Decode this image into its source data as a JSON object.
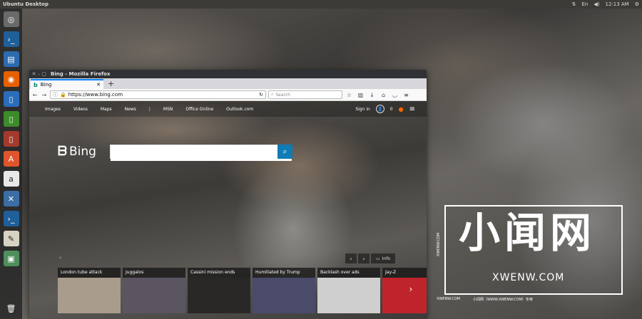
{
  "top_panel": {
    "title": "Ubuntu Desktop",
    "clock": "12:13 AM",
    "kbd": "En"
  },
  "launcher": {
    "items": [
      {
        "name": "ubuntu-dash-icon",
        "color": "#6a6a6a",
        "glyph": "◎"
      },
      {
        "name": "terminal-icon",
        "color": "#1f5f9a",
        "glyph": "›_"
      },
      {
        "name": "files-icon",
        "color": "#2d6bb0",
        "glyph": "▤"
      },
      {
        "name": "firefox-icon",
        "color": "#e66000",
        "glyph": "◉"
      },
      {
        "name": "libreoffice-writer-icon",
        "color": "#2a6ebb",
        "glyph": "▯"
      },
      {
        "name": "libreoffice-calc-icon",
        "color": "#3c8c2a",
        "glyph": "▯"
      },
      {
        "name": "libreoffice-impress-icon",
        "color": "#a33b2c",
        "glyph": "▯"
      },
      {
        "name": "software-center-icon",
        "color": "#e0552d",
        "glyph": "A"
      },
      {
        "name": "amazon-icon",
        "color": "#e8e8e8",
        "glyph": "a"
      },
      {
        "name": "system-tools-icon",
        "color": "#3a6ea5",
        "glyph": "✕"
      },
      {
        "name": "terminal-2-icon",
        "color": "#1f5f9a",
        "glyph": "›_"
      },
      {
        "name": "text-editor-icon",
        "color": "#d8d2c4",
        "glyph": "✎"
      },
      {
        "name": "image-viewer-icon",
        "color": "#4e8f5c",
        "glyph": "▣"
      }
    ],
    "trash_glyph": "🗑"
  },
  "firefox": {
    "window_title": "Bing - Mozilla Firefox",
    "tab_label": "Bing",
    "url": "https://www.bing.com",
    "search_placeholder": "Search",
    "new_tab": "+"
  },
  "bing": {
    "nav_links": [
      "Images",
      "Videos",
      "Maps",
      "News",
      "MSN",
      "Office Online",
      "Outlook.com"
    ],
    "sign_in": "Sign in",
    "rewards_count": "0",
    "logo_text": "Bing",
    "info_label": "Info",
    "news": [
      {
        "caption": "London tube attack",
        "color": "#a89c8c"
      },
      {
        "caption": "Juggalos",
        "color": "#5a5560"
      },
      {
        "caption": "Cassini mission ends",
        "color": "#2a2826"
      },
      {
        "caption": "Humiliated by Trump",
        "color": "#4a4a6a"
      },
      {
        "caption": "Backlash over ads",
        "color": "#cfcfcf"
      },
      {
        "caption": "Jay-Z",
        "color": "#c0242b"
      }
    ]
  },
  "watermark": {
    "chinese": "小闻网",
    "domain": "XWENW.COM",
    "side_text": "XWENW.COM",
    "bottom_left": "XWENW.COM",
    "bottom_right": "小闻网（WWW.XWENW.COM）专用"
  }
}
